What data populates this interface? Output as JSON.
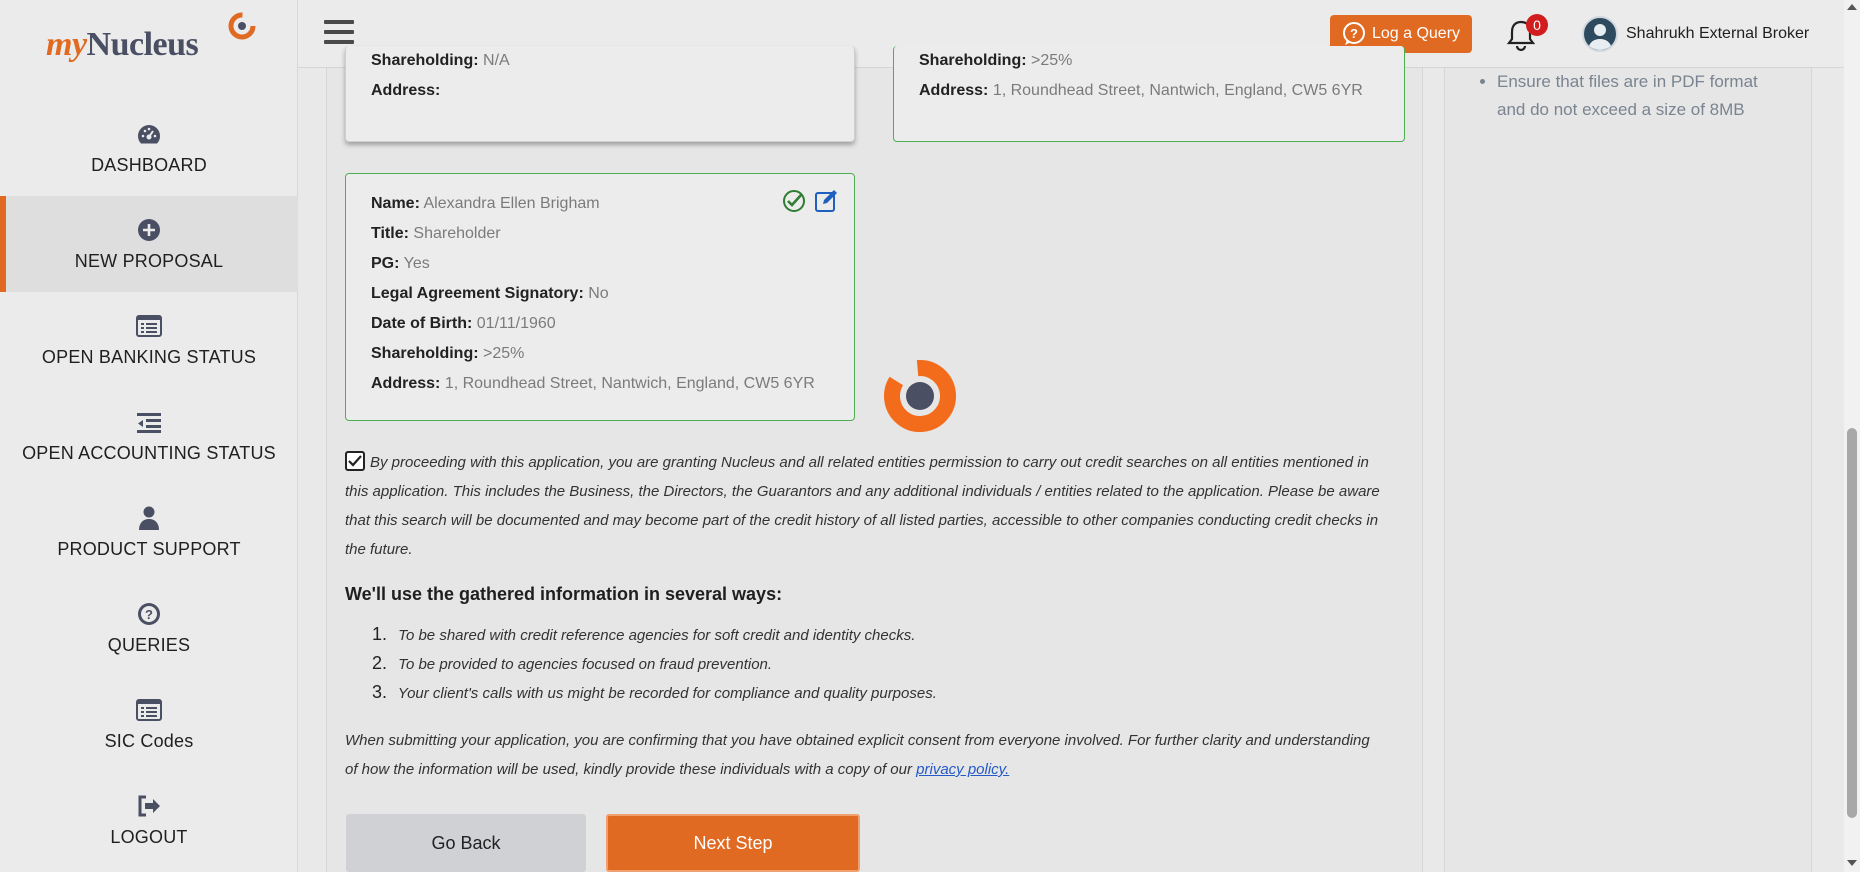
{
  "logo": {
    "my": "my",
    "nucleus": "Nucleus"
  },
  "sidebar": {
    "items": [
      {
        "label": "DASHBOARD",
        "icon": "dashboard-gauge-icon"
      },
      {
        "label": "NEW PROPOSAL",
        "icon": "plus-circle-icon"
      },
      {
        "label": "OPEN BANKING STATUS",
        "icon": "list-window-icon"
      },
      {
        "label": "OPEN ACCOUNTING STATUS",
        "icon": "outdent-list-icon"
      },
      {
        "label": "PRODUCT SUPPORT",
        "icon": "user-icon"
      },
      {
        "label": "QUERIES",
        "icon": "question-circle-icon"
      },
      {
        "label": "SIC Codes",
        "icon": "list-window-icon"
      },
      {
        "label": "LOGOUT",
        "icon": "sign-out-icon"
      }
    ],
    "active": "NEW PROPOSAL"
  },
  "header": {
    "log_query": "Log a Query",
    "notifications": "0",
    "user_name": "Shahrukh External Broker"
  },
  "guidance": {
    "items": [
      "Ensure that files are in PDF format and do not exceed a size of 8MB"
    ]
  },
  "cards": {
    "a": {
      "shareholding_k": "Shareholding:",
      "shareholding_v": "N/A",
      "address_k": "Address:",
      "address_v": ""
    },
    "b": {
      "shareholding_k": "Shareholding:",
      "shareholding_v": ">25%",
      "address_k": "Address:",
      "address_v": "1, Roundhead Street, Nantwich, England, CW5 6YR"
    },
    "c": {
      "name_k": "Name:",
      "name_v": "Alexandra Ellen Brigham",
      "title_k": "Title:",
      "title_v": "Shareholder",
      "pg_k": "PG:",
      "pg_v": "Yes",
      "signatory_k": "Legal Agreement Signatory:",
      "signatory_v": "No",
      "dob_k": "Date of Birth:",
      "dob_v": "01/11/1960",
      "shareholding_k": "Shareholding:",
      "shareholding_v": ">25%",
      "address_k": "Address:",
      "address_v": "1, Roundhead Street, Nantwich, England, CW5 6YR"
    }
  },
  "consent": {
    "checked": true,
    "text": "By proceeding with this application, you are granting Nucleus and all related entities permission to carry out credit searches on all entities mentioned in this application. This includes the Business, the Directors, the Guarantors and any additional individuals / entities related to the application. Please be aware that this search will be documented and may become part of the credit history of all listed parties, accessible to other companies conducting credit checks in the future."
  },
  "usage": {
    "heading": "We'll use the gathered information in several ways:",
    "items": [
      "To be shared with credit reference agencies for soft credit and identity checks.",
      "To be provided to agencies focused on fraud prevention.",
      "Your client's calls with us might be recorded for compliance and quality purposes."
    ]
  },
  "submission": {
    "text": "When submitting your application, you are confirming that you have obtained explicit consent from everyone involved. For further clarity and understanding of how the information will be used, kindly provide these individuals with a copy of our ",
    "link": "privacy policy."
  },
  "buttons": {
    "back": "Go Back",
    "next": "Next Step"
  },
  "colors": {
    "accent": "#e06a22",
    "valid_border": "#4caf50",
    "link": "#2459c7"
  }
}
